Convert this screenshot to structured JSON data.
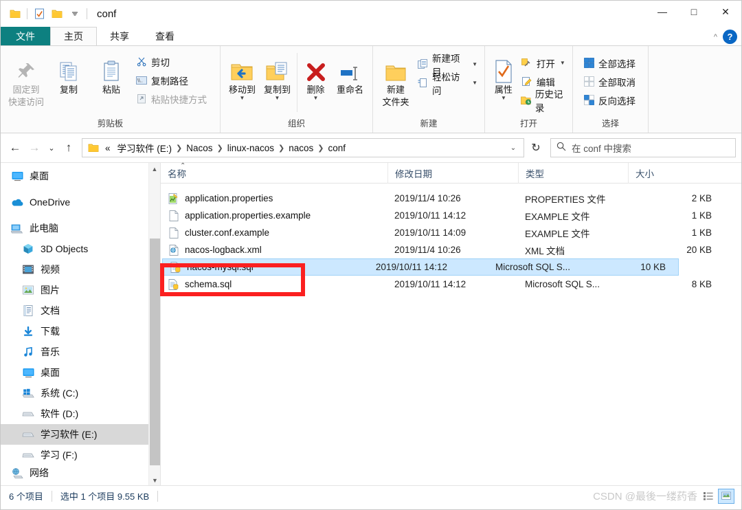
{
  "window": {
    "title": "conf",
    "quick_access": [
      "folder-icon",
      "properties-check-icon",
      "new-folder-icon",
      "customize-dropdown-icon"
    ],
    "controls": {
      "minimize": "—",
      "maximize": "□",
      "close": "✕"
    }
  },
  "tabs": [
    {
      "id": "file",
      "label": "文件"
    },
    {
      "id": "home",
      "label": "主页"
    },
    {
      "id": "share",
      "label": "共享"
    },
    {
      "id": "view",
      "label": "查看"
    }
  ],
  "ribbon": {
    "help_label": "?",
    "groups": [
      {
        "name": "clipboard",
        "label": "剪贴板",
        "big_buttons": [
          {
            "name": "pin-to-quick-access",
            "label": "固定到\n快速访问",
            "line1": "固定到",
            "line2": "快速访问",
            "icon": "pin-icon",
            "disabled": true
          },
          {
            "name": "copy",
            "label": "复制",
            "line1": "复制",
            "line2": "",
            "icon": "copy-icon",
            "disabled": false
          },
          {
            "name": "paste",
            "label": "粘贴",
            "line1": "粘贴",
            "line2": "",
            "icon": "paste-icon",
            "disabled": false
          }
        ],
        "small_buttons": [
          {
            "name": "cut",
            "label": "剪切",
            "icon": "scissors-icon",
            "disabled": false
          },
          {
            "name": "copy-path",
            "label": "复制路径",
            "icon": "copy-path-icon",
            "disabled": false
          },
          {
            "name": "paste-shortcut",
            "label": "粘贴快捷方式",
            "icon": "paste-shortcut-icon",
            "disabled": true
          }
        ]
      },
      {
        "name": "organize",
        "label": "组织",
        "big_buttons": [
          {
            "name": "move-to",
            "label": "移动到",
            "line1": "移动到",
            "line2": "",
            "icon": "move-to-icon",
            "caret": true
          },
          {
            "name": "copy-to",
            "label": "复制到",
            "line1": "复制到",
            "line2": "",
            "icon": "copy-to-icon",
            "caret": true
          },
          {
            "name": "delete",
            "label": "删除",
            "line1": "删除",
            "line2": "",
            "icon": "delete-icon",
            "caret": true
          },
          {
            "name": "rename",
            "label": "重命名",
            "line1": "重命名",
            "line2": "",
            "icon": "rename-icon",
            "caret": false
          }
        ]
      },
      {
        "name": "new",
        "label": "新建",
        "big_buttons": [
          {
            "name": "new-folder",
            "label": "新建\n文件夹",
            "line1": "新建",
            "line2": "文件夹",
            "icon": "new-folder-icon",
            "caret": false
          }
        ],
        "small_buttons": [
          {
            "name": "new-item",
            "label": "新建项目",
            "icon": "new-item-icon",
            "caret": true
          },
          {
            "name": "easy-access",
            "label": "轻松访问",
            "icon": "easy-access-icon",
            "caret": true
          }
        ]
      },
      {
        "name": "open",
        "label": "打开",
        "big_buttons": [
          {
            "name": "properties",
            "label": "属性",
            "line1": "属性",
            "line2": "",
            "icon": "properties-icon",
            "caret": true
          }
        ],
        "small_buttons": [
          {
            "name": "open",
            "label": "打开",
            "icon": "open-icon",
            "caret": true
          },
          {
            "name": "edit",
            "label": "编辑",
            "icon": "edit-icon",
            "caret": false
          },
          {
            "name": "history",
            "label": "历史记录",
            "icon": "history-icon",
            "caret": false
          }
        ]
      },
      {
        "name": "select",
        "label": "选择",
        "small_buttons": [
          {
            "name": "select-all",
            "label": "全部选择",
            "icon": "select-all-icon"
          },
          {
            "name": "select-none",
            "label": "全部取消",
            "icon": "select-none-icon"
          },
          {
            "name": "invert-selection",
            "label": "反向选择",
            "icon": "invert-selection-icon"
          }
        ]
      }
    ]
  },
  "address": {
    "back": "←",
    "forward": "→",
    "recent": "⌄",
    "up": "↑",
    "folder_icon": "folder-icon",
    "prefix": "«",
    "crumbs": [
      "学习软件 (E:)",
      "Nacos",
      "linux-nacos",
      "nacos",
      "conf"
    ],
    "dropdown": "⌄",
    "refresh": "↻",
    "search_placeholder": "在 conf 中搜索",
    "search_value": ""
  },
  "nav_pane": {
    "items": [
      {
        "name": "desktop-top",
        "label": "桌面",
        "icon": "desktop-icon",
        "indent": false,
        "selected": false
      },
      {
        "name": "onedrive",
        "label": "OneDrive",
        "icon": "onedrive-icon",
        "indent": false,
        "selected": false
      },
      {
        "name": "this-pc",
        "label": "此电脑",
        "icon": "this-pc-icon",
        "indent": false,
        "selected": false
      },
      {
        "name": "3d-objects",
        "label": "3D Objects",
        "icon": "3d-objects-icon",
        "indent": true,
        "selected": false
      },
      {
        "name": "videos",
        "label": "视频",
        "icon": "videos-icon",
        "indent": true,
        "selected": false
      },
      {
        "name": "pictures",
        "label": "图片",
        "icon": "pictures-icon",
        "indent": true,
        "selected": false
      },
      {
        "name": "documents",
        "label": "文档",
        "icon": "documents-icon",
        "indent": true,
        "selected": false
      },
      {
        "name": "downloads",
        "label": "下载",
        "icon": "downloads-icon",
        "indent": true,
        "selected": false
      },
      {
        "name": "music",
        "label": "音乐",
        "icon": "music-icon",
        "indent": true,
        "selected": false
      },
      {
        "name": "desktop",
        "label": "桌面",
        "icon": "desktop-icon",
        "indent": true,
        "selected": false
      },
      {
        "name": "drive-c",
        "label": "系统 (C:)",
        "icon": "windows-drive-icon",
        "indent": true,
        "selected": false
      },
      {
        "name": "drive-d",
        "label": "软件 (D:)",
        "icon": "drive-icon",
        "indent": true,
        "selected": false
      },
      {
        "name": "drive-e",
        "label": "学习软件 (E:)",
        "icon": "drive-icon",
        "indent": true,
        "selected": true
      },
      {
        "name": "drive-f",
        "label": "学习 (F:)",
        "icon": "drive-icon",
        "indent": true,
        "selected": false
      },
      {
        "name": "network",
        "label": "网络",
        "icon": "network-icon",
        "indent": false,
        "selected": false
      }
    ]
  },
  "file_list": {
    "columns": [
      {
        "name": "name",
        "label": "名称",
        "sorted": true,
        "sort_mark": "⌃"
      },
      {
        "name": "date-modified",
        "label": "修改日期"
      },
      {
        "name": "type",
        "label": "类型"
      },
      {
        "name": "size",
        "label": "大小"
      }
    ],
    "rows": [
      {
        "name": "application.properties",
        "date": "2019/11/4 10:26",
        "type": "PROPERTIES 文件",
        "size": "2 KB",
        "icon": "properties-file-icon",
        "selected": false
      },
      {
        "name": "application.properties.example",
        "date": "2019/10/11 14:12",
        "type": "EXAMPLE 文件",
        "size": "1 KB",
        "icon": "blank-file-icon",
        "selected": false
      },
      {
        "name": "cluster.conf.example",
        "date": "2019/10/11 14:09",
        "type": "EXAMPLE 文件",
        "size": "1 KB",
        "icon": "blank-file-icon",
        "selected": false
      },
      {
        "name": "nacos-logback.xml",
        "date": "2019/11/4 10:26",
        "type": "XML 文档",
        "size": "20 KB",
        "icon": "xml-file-icon",
        "selected": false
      },
      {
        "name": "nacos-mysql.sql",
        "date": "2019/10/11 14:12",
        "type": "Microsoft SQL S...",
        "size": "10 KB",
        "icon": "sql-file-icon",
        "selected": true
      },
      {
        "name": "schema.sql",
        "date": "2019/10/11 14:12",
        "type": "Microsoft SQL S...",
        "size": "8 KB",
        "icon": "sql-file-icon",
        "selected": false
      }
    ]
  },
  "annotation": {
    "name": "red-highlight-box",
    "color": "#fb2020"
  },
  "status_bar": {
    "item_count": "6 个项目",
    "selection": "选中 1 个项目  9.55 KB",
    "watermark": "CSDN @最後一缕药香",
    "views": [
      {
        "name": "details-view-button",
        "icon": "details-view-icon",
        "active": false
      },
      {
        "name": "large-icons-view-button",
        "icon": "large-icons-view-icon",
        "active": true
      }
    ]
  },
  "colors": {
    "accent": "#0a67c4",
    "selection": "#cce8ff",
    "file_tab": "#0d8080",
    "annotation": "#fb2020"
  }
}
